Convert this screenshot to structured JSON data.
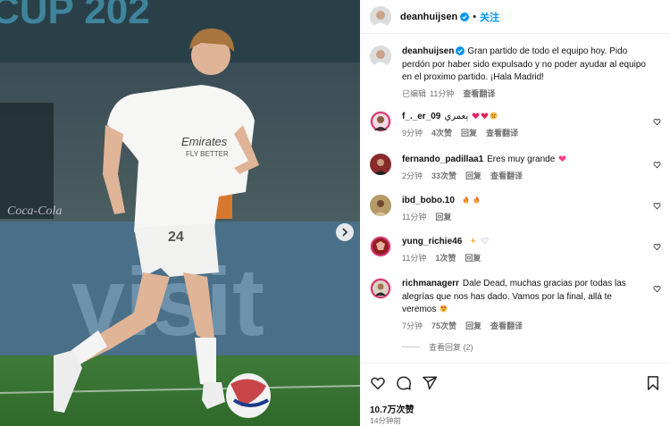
{
  "post": {
    "username": "deanhuijsen",
    "follow_label": "关注",
    "separator": "•",
    "caption": "Gran partido de todo el equipo hoy. Pido perdón por haber sido expulsado y no poder ayudar al equipo en el proximo partido. ¡Hala Madrid!",
    "caption_meta": [
      "已编辑",
      "11分钟",
      "查看翻译"
    ],
    "likes": "10.7万次赞",
    "time": "14分钟前"
  },
  "photo": {
    "banner_text": "CUP 202",
    "shirt_sponsor_1": "Emirates",
    "shirt_sponsor_2": "FLY BETTER",
    "shirt_number": "24",
    "board_text": "visit",
    "logo_text": "Coca-Cola"
  },
  "comments": [
    {
      "username": "f_._er_09",
      "text": "يعمري",
      "meta": [
        "9分钟",
        "4次赞",
        "回复",
        "查看翻译"
      ],
      "emojis": [
        "red-heart",
        "red-heart",
        "sad-face"
      ]
    },
    {
      "username": "fernando_padillaa1",
      "text": "Eres muy grande",
      "meta": [
        "2分钟",
        "33次赞",
        "回复",
        "查看翻译"
      ],
      "emojis": [
        "pink-heart"
      ]
    },
    {
      "username": "ibd_bobo.10",
      "text": "",
      "meta": [
        "11分钟",
        "回复"
      ],
      "emojis": [
        "fire",
        "fire"
      ]
    },
    {
      "username": "yung_richie46",
      "text": "",
      "meta": [
        "11分钟",
        "1次赞",
        "回复"
      ],
      "emojis": [
        "lightning",
        "white-heart"
      ]
    },
    {
      "username": "richmanagerr",
      "text": "Dale Dead, muchas gracias por todas las alegrías que nos has dado. Vamos por la final, allá te veremos",
      "meta": [
        "7分钟",
        "75次赞",
        "回复",
        "查看翻译"
      ],
      "emojis": [
        "heart-eyes"
      ]
    }
  ],
  "view_replies": "查看回复 (2)",
  "icons": [
    "heart-icon",
    "comment-icon",
    "share-icon",
    "bookmark-icon",
    "verified-icon",
    "chevron-right-icon"
  ],
  "colors": {
    "link": "#0095f6",
    "meta": "#737373",
    "verified": "#0095f6",
    "heart": "#ed4956"
  }
}
